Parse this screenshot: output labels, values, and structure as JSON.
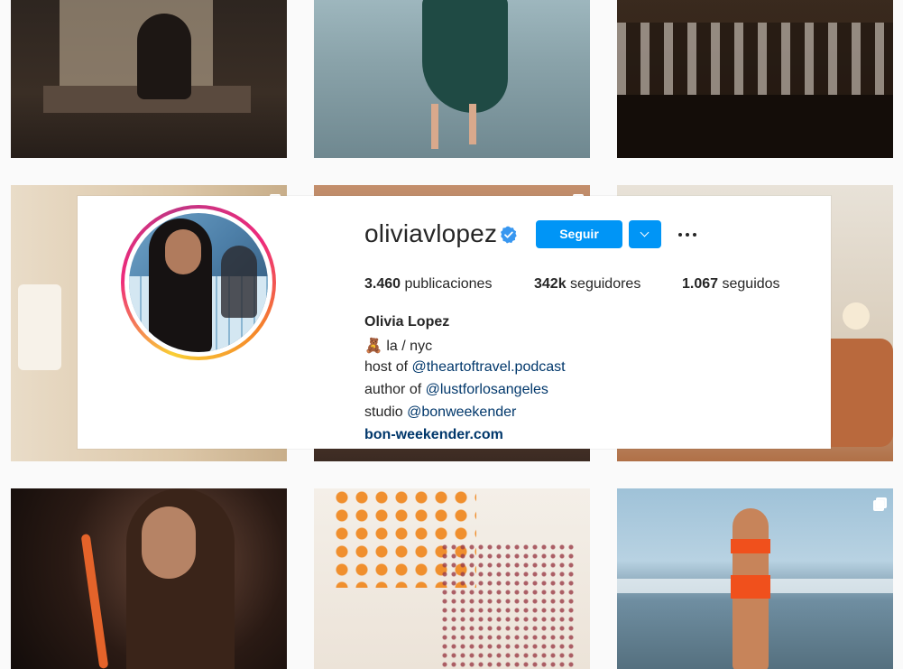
{
  "profile": {
    "username": "oliviavlopez",
    "follow_label": "Seguir",
    "stats": [
      {
        "value": "3.460",
        "label": "publicaciones"
      },
      {
        "value": "342k",
        "label": "seguidores"
      },
      {
        "value": "1.067",
        "label": "seguidos"
      }
    ],
    "full_name": "Olivia Lopez",
    "bio": {
      "line1_emoji": "🧸",
      "line1_text": "la / nyc",
      "line2_prefix": "host of ",
      "line2_link": "@theartoftravel.podcast",
      "line3_prefix": "author of ",
      "line3_link": "@lustforlosangeles",
      "line4_prefix": "studio ",
      "line4_link": "@bonweekender",
      "website": "bon-weekender.com"
    }
  },
  "colors": {
    "primary_button": "#0095f6",
    "link": "#00376b",
    "text": "#262626"
  },
  "icons": [
    "verified-badge-icon",
    "chevron-down-icon",
    "more-options-icon",
    "multiple-photos-icon"
  ]
}
